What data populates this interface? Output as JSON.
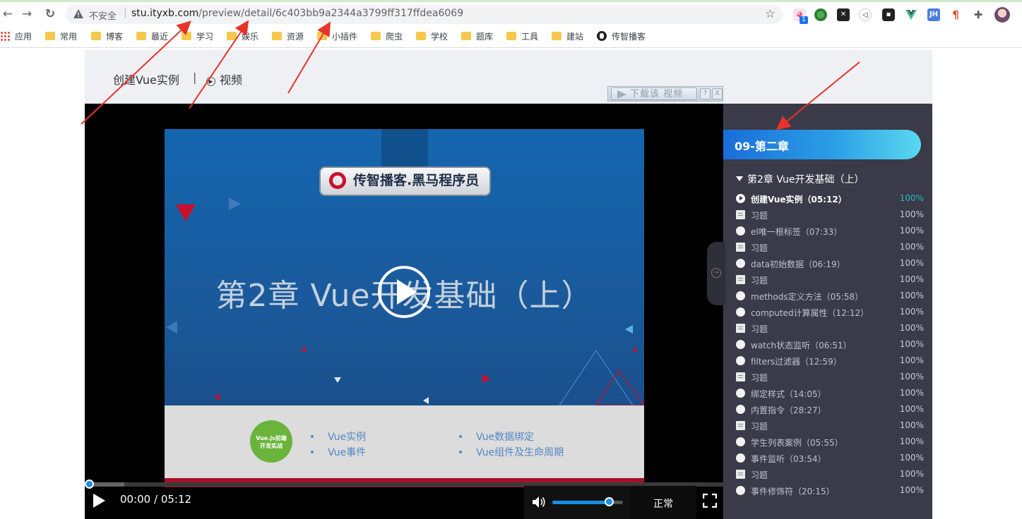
{
  "browser": {
    "insecure_label": "不安全",
    "url_host": "stu.ityxb.com",
    "url_path": "/preview/detail/6c403bb9a2344a3799ff317ffdea6069",
    "extension_badge": "1",
    "extensions": [
      "tabby-cat-icon",
      "globe-green-icon",
      "x-icon",
      "sound-icon",
      "ghost-icon",
      "vue-icon",
      "jh-icon",
      "pilcrow-icon",
      "puzzle-icon",
      "profile-avatar"
    ],
    "extension_labels": {
      "jh": "JH"
    }
  },
  "bookmarks": [
    {
      "label": "应用",
      "icon": "apps-icon"
    },
    {
      "label": "常用",
      "icon": "folder-icon"
    },
    {
      "label": "博客",
      "icon": "folder-icon"
    },
    {
      "label": "最近",
      "icon": "folder-icon"
    },
    {
      "label": "学习",
      "icon": "folder-icon"
    },
    {
      "label": "娱乐",
      "icon": "folder-icon"
    },
    {
      "label": "资源",
      "icon": "folder-icon"
    },
    {
      "label": "小插件",
      "icon": "folder-icon"
    },
    {
      "label": "爬虫",
      "icon": "folder-icon"
    },
    {
      "label": "学校",
      "icon": "folder-icon"
    },
    {
      "label": "题库",
      "icon": "folder-icon"
    },
    {
      "label": "工具",
      "icon": "folder-icon"
    },
    {
      "label": "建站",
      "icon": "folder-icon"
    },
    {
      "label": "传智播客",
      "icon": "globe-icon"
    }
  ],
  "course_header": {
    "title": "创建Vue实例",
    "separator": "|",
    "video_label": "视频",
    "download_label": "下载该 视频",
    "download_help": "?",
    "download_close": "X"
  },
  "slide": {
    "logo_text": "传智播客.黑马程序员",
    "title": "第2章 Vue开发基础（上）",
    "badge_line1": "Vue.js前端",
    "badge_line2": "开发实战",
    "topics": [
      "Vue实例",
      "Vue事件",
      "Vue数据绑定",
      "Vue组件及生命周期"
    ]
  },
  "player": {
    "time": "00:00 / 05:12",
    "speed": "正常",
    "progress": 0,
    "volume": 0.8
  },
  "sidebar": {
    "chapter": "09-第二章",
    "section": "第2章 Vue开发基础（上）",
    "lessons": [
      {
        "name": "创建Vue实例（05:12）",
        "pct": "100%",
        "type": "video",
        "active": true
      },
      {
        "name": "习题",
        "pct": "100%",
        "type": "exercise"
      },
      {
        "name": "el唯一根标签（07:33）",
        "pct": "100%",
        "type": "video"
      },
      {
        "name": "习题",
        "pct": "100%",
        "type": "exercise"
      },
      {
        "name": "data初始数据（06:19）",
        "pct": "100%",
        "type": "video"
      },
      {
        "name": "习题",
        "pct": "100%",
        "type": "exercise"
      },
      {
        "name": "methods定义方法（05:58）",
        "pct": "100%",
        "type": "video"
      },
      {
        "name": "computed计算属性（12:12）",
        "pct": "100%",
        "type": "video"
      },
      {
        "name": "习题",
        "pct": "100%",
        "type": "exercise"
      },
      {
        "name": "watch状态监听（06:51）",
        "pct": "100%",
        "type": "video"
      },
      {
        "name": "filters过滤器（12:59）",
        "pct": "100%",
        "type": "video"
      },
      {
        "name": "习题",
        "pct": "100%",
        "type": "exercise"
      },
      {
        "name": "绑定样式（14:05）",
        "pct": "100%",
        "type": "video"
      },
      {
        "name": "内置指令（28:27）",
        "pct": "100%",
        "type": "video"
      },
      {
        "name": "习题",
        "pct": "100%",
        "type": "exercise"
      },
      {
        "name": "学生列表案例（05:55）",
        "pct": "100%",
        "type": "video"
      },
      {
        "name": "事件监听（03:54）",
        "pct": "100%",
        "type": "video"
      },
      {
        "name": "习题",
        "pct": "100%",
        "type": "exercise"
      },
      {
        "name": "事件修饰符（20:15）",
        "pct": "100%",
        "type": "video"
      }
    ]
  },
  "colors": {
    "annotation_arrow": "#e8332a",
    "banner_start": "#1a6ed8",
    "banner_end": "#5ad8f0",
    "active_pct": "#2bb5c4",
    "progress": "#1a8fe3"
  }
}
